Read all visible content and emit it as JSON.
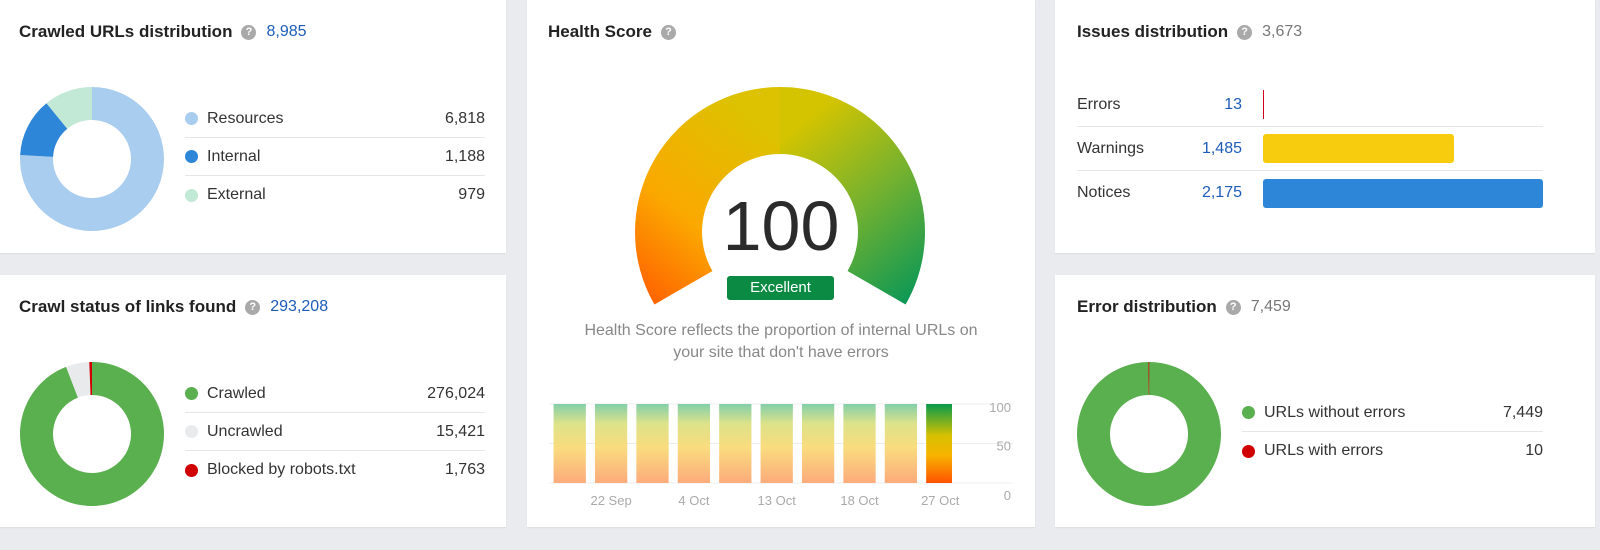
{
  "crawled_urls": {
    "title": "Crawled URLs distribution",
    "total": "8,985",
    "help_icon": "question-circle-icon",
    "items": [
      {
        "label": "Resources",
        "value": "6,818",
        "raw": 6818,
        "color": "#a9cdef"
      },
      {
        "label": "Internal",
        "value": "1,188",
        "raw": 1188,
        "color": "#2e86d8"
      },
      {
        "label": "External",
        "value": "979",
        "raw": 979,
        "color": "#c2e8d6"
      }
    ]
  },
  "crawl_status": {
    "title": "Crawl status of links found",
    "total": "293,208",
    "help_icon": "question-circle-icon",
    "items": [
      {
        "label": "Crawled",
        "value": "276,024",
        "raw": 276024,
        "color": "#5aaf4f"
      },
      {
        "label": "Uncrawled",
        "value": "15,421",
        "raw": 15421,
        "color": "#e8eaec"
      },
      {
        "label": "Blocked by robots.txt",
        "value": "1,763",
        "raw": 1763,
        "color": "#d00000"
      }
    ]
  },
  "health_score": {
    "title": "Health Score",
    "help_icon": "question-circle-icon",
    "score": "100",
    "score_value": 100,
    "rating": "Excellent",
    "rating_color": "#0b8a43",
    "description_line1": "Health Score reflects the proportion of internal URLs on",
    "description_line2": "your site that don't have errors",
    "trend": {
      "x_labels": [
        "22 Sep",
        "4 Oct",
        "13 Oct",
        "18 Oct",
        "27 Oct"
      ],
      "y_ticks": [
        "100",
        "50",
        "0"
      ],
      "ylim": [
        0,
        100
      ],
      "values": [
        100,
        100,
        100,
        100,
        100,
        100,
        100,
        100,
        100,
        100
      ],
      "highlight_last": true
    }
  },
  "issues": {
    "title": "Issues distribution",
    "total": "3,673",
    "help_icon": "question-circle-icon",
    "rows": [
      {
        "label": "Errors",
        "value": "13",
        "raw": 13,
        "color": "#d0021b"
      },
      {
        "label": "Warnings",
        "value": "1,485",
        "raw": 1485,
        "color": "#f8cc0e"
      },
      {
        "label": "Notices",
        "value": "2,175",
        "raw": 2175,
        "color": "#2e86d8"
      }
    ]
  },
  "error_distribution": {
    "title": "Error distribution",
    "total": "7,459",
    "help_icon": "question-circle-icon",
    "items": [
      {
        "label": "URLs without errors",
        "value": "7,449",
        "raw": 7449,
        "color": "#5aaf4f"
      },
      {
        "label": "URLs with errors",
        "value": "10",
        "raw": 10,
        "color": "#d00000"
      }
    ]
  }
}
